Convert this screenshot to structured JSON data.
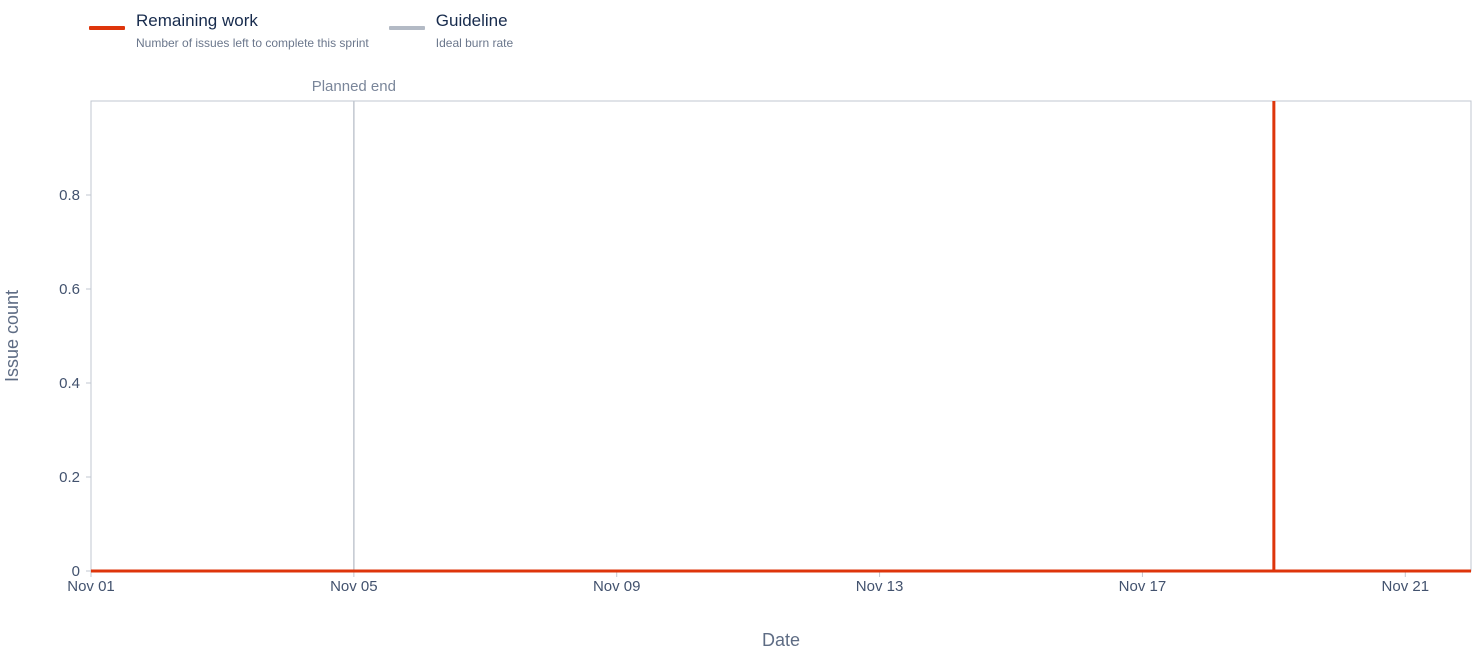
{
  "legend": {
    "items": [
      {
        "title": "Remaining work",
        "subtitle": "Number of issues left to complete this sprint",
        "color": "#de350b"
      },
      {
        "title": "Guideline",
        "subtitle": "Ideal burn rate",
        "color": "#b3bac5"
      }
    ]
  },
  "chart_data": {
    "type": "line",
    "xlabel": "Date",
    "ylabel": "Issue count",
    "x_range": [
      "Nov 01",
      "Nov 22"
    ],
    "ylim": [
      0,
      1
    ],
    "x_ticks": [
      "Nov 01",
      "Nov 05",
      "Nov 09",
      "Nov 13",
      "Nov 17",
      "Nov 21"
    ],
    "y_ticks": [
      "0",
      "0.2",
      "0.4",
      "0.6",
      "0.8"
    ],
    "grid": false,
    "legend_position": "top-left",
    "markers": [
      {
        "label": "Planned end",
        "x": "Nov 05",
        "color": "#c1c7d0"
      }
    ],
    "series": [
      {
        "name": "Remaining work",
        "color": "#de350b",
        "points": [
          {
            "x": "Nov 01",
            "y": 0
          },
          {
            "x": "Nov 19",
            "y": 0
          },
          {
            "x": "Nov 19",
            "y": 1
          },
          {
            "x": "Nov 19",
            "y": 0
          },
          {
            "x": "Nov 22",
            "y": 0
          }
        ]
      }
    ]
  }
}
